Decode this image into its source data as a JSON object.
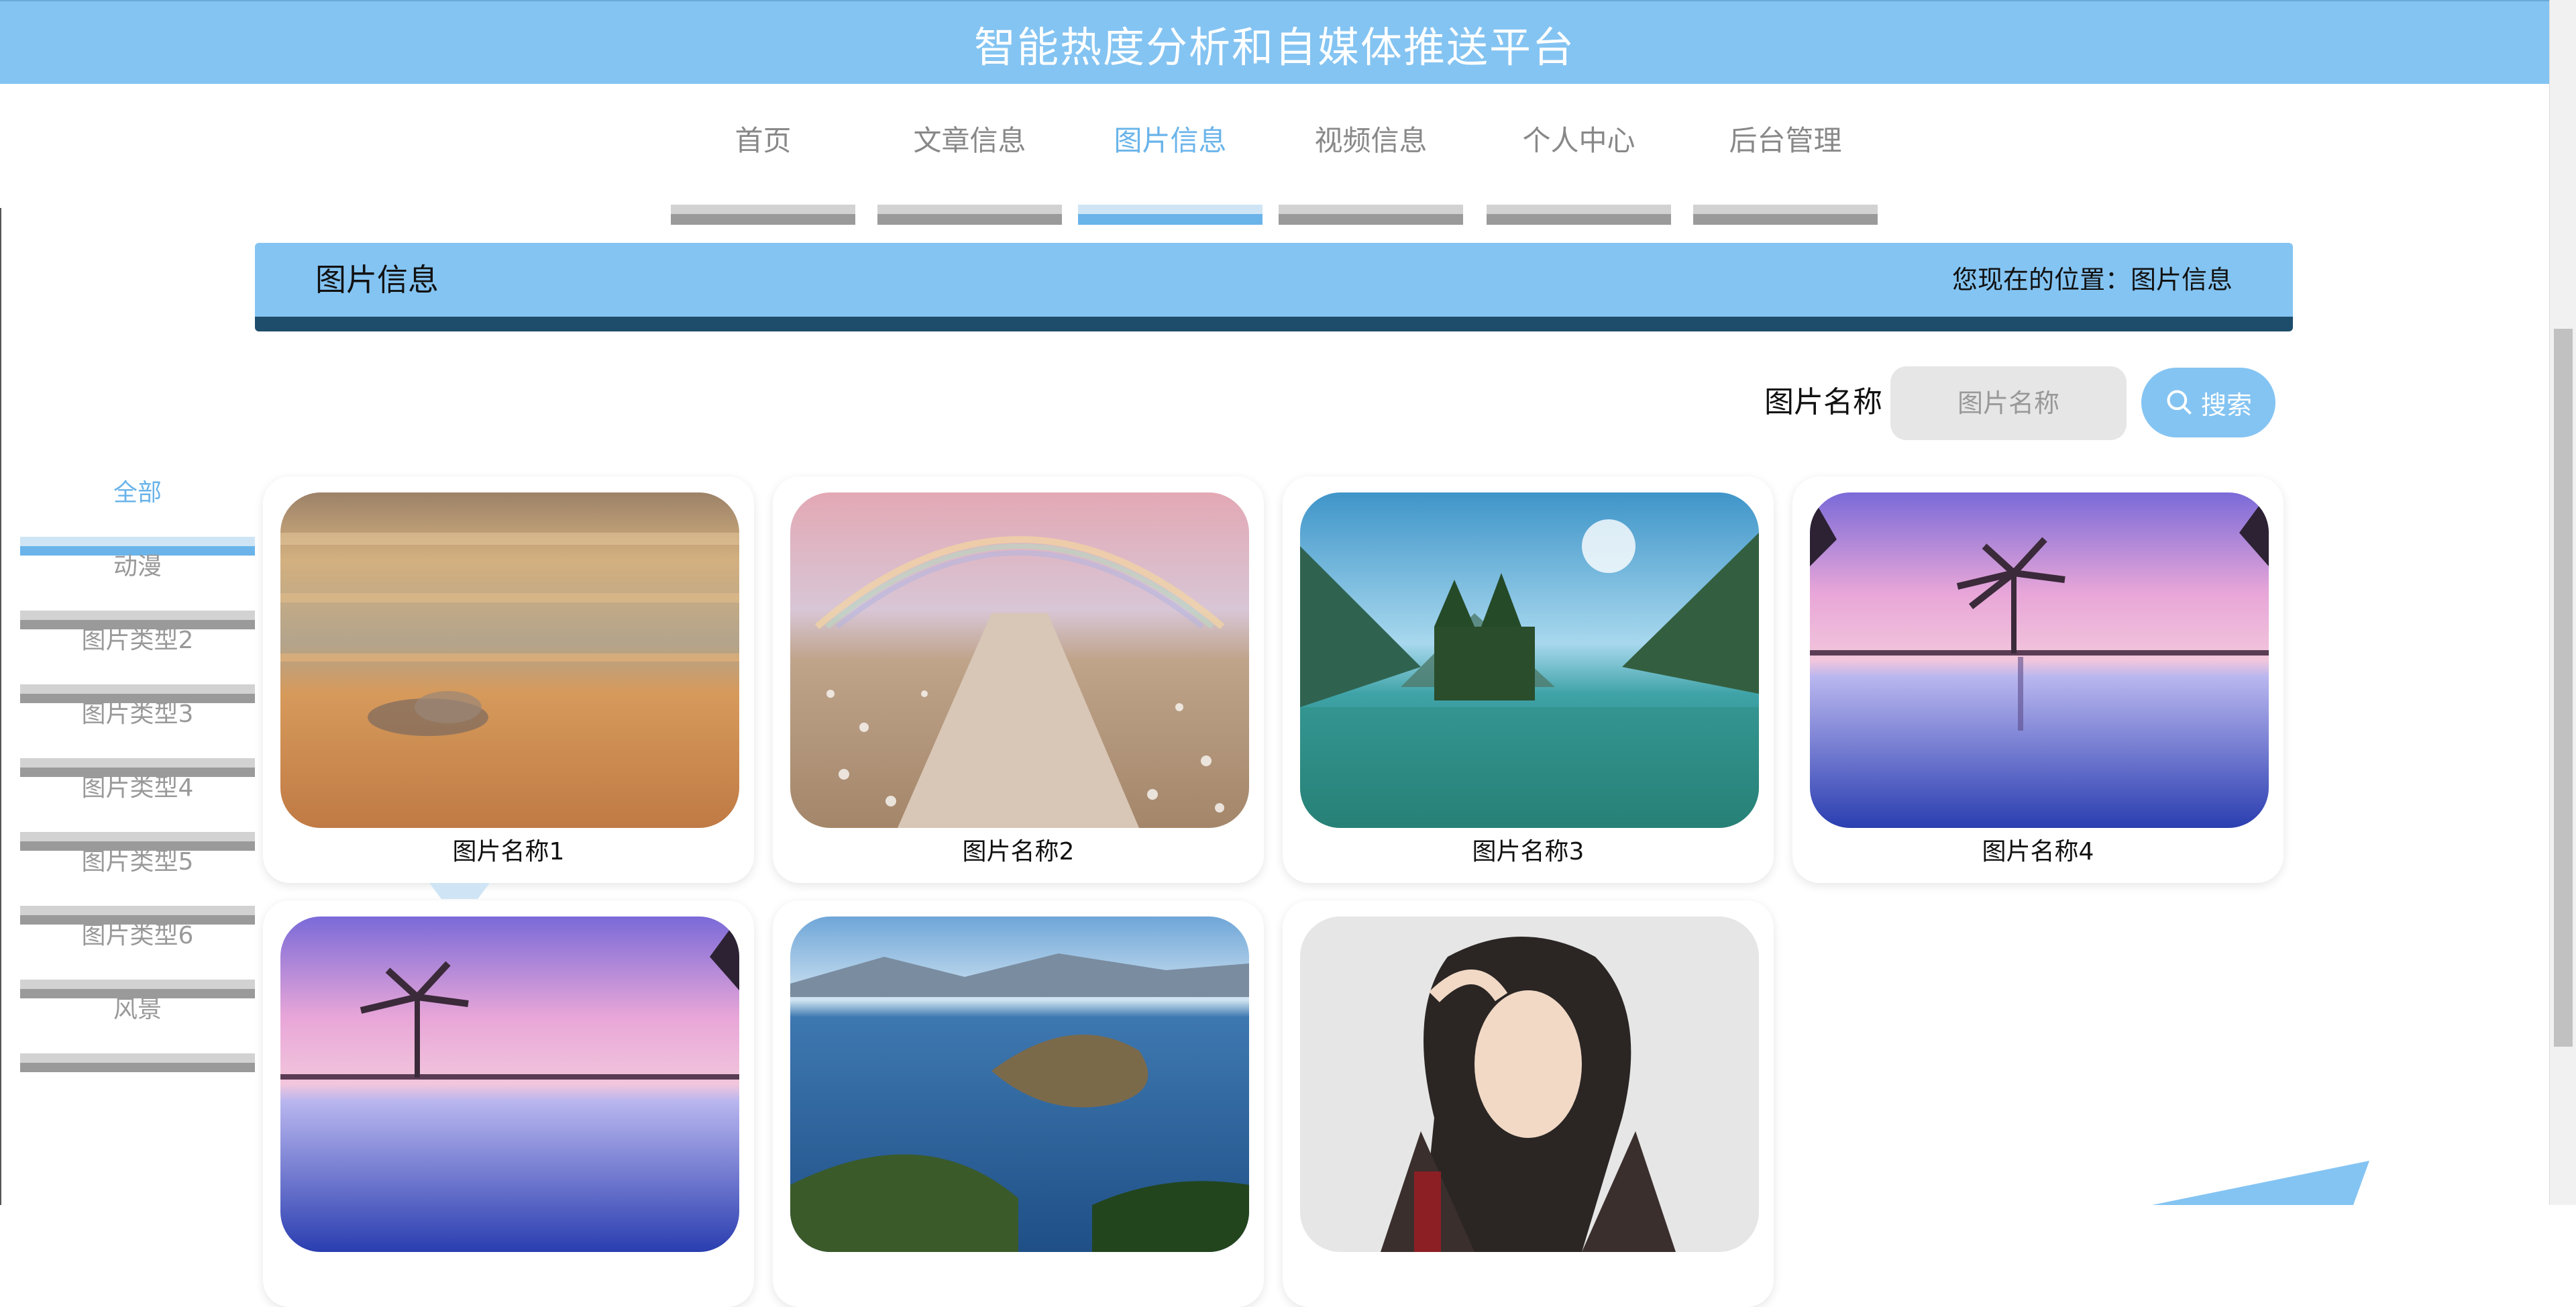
{
  "header": {
    "title": "智能热度分析和自媒体推送平台"
  },
  "nav": {
    "items": [
      {
        "label": "首页",
        "active": false
      },
      {
        "label": "文章信息",
        "active": false
      },
      {
        "label": "图片信息",
        "active": true
      },
      {
        "label": "视频信息",
        "active": false
      },
      {
        "label": "个人中心",
        "active": false
      },
      {
        "label": "后台管理",
        "active": false
      }
    ]
  },
  "section": {
    "title": "图片信息",
    "breadcrumb": "您现在的位置：图片信息"
  },
  "search": {
    "label": "图片名称",
    "placeholder": "图片名称",
    "button_label": "搜索"
  },
  "sidebar": {
    "items": [
      {
        "label": "全部",
        "active": true
      },
      {
        "label": "动漫",
        "active": false
      },
      {
        "label": "图片类型2",
        "active": false
      },
      {
        "label": "图片类型3",
        "active": false
      },
      {
        "label": "图片类型4",
        "active": false
      },
      {
        "label": "图片类型5",
        "active": false
      },
      {
        "label": "图片类型6",
        "active": false
      },
      {
        "label": "风景",
        "active": false
      }
    ]
  },
  "gallery": {
    "items": [
      {
        "name": "图片名称1",
        "image": "sunset-clouds"
      },
      {
        "name": "图片名称2",
        "image": "rainbow-flower-path"
      },
      {
        "name": "图片名称3",
        "image": "mountain-lake"
      },
      {
        "name": "图片名称4",
        "image": "palm-pool-sunset"
      },
      {
        "name": "",
        "image": "palm-pool-sunset"
      },
      {
        "name": "",
        "image": "lake-island"
      },
      {
        "name": "",
        "image": "anime-character"
      }
    ]
  },
  "colors": {
    "accent": "#84c4f2",
    "header_underline": "#1e4d6b",
    "inactive_bar": "#9a9a9a"
  }
}
